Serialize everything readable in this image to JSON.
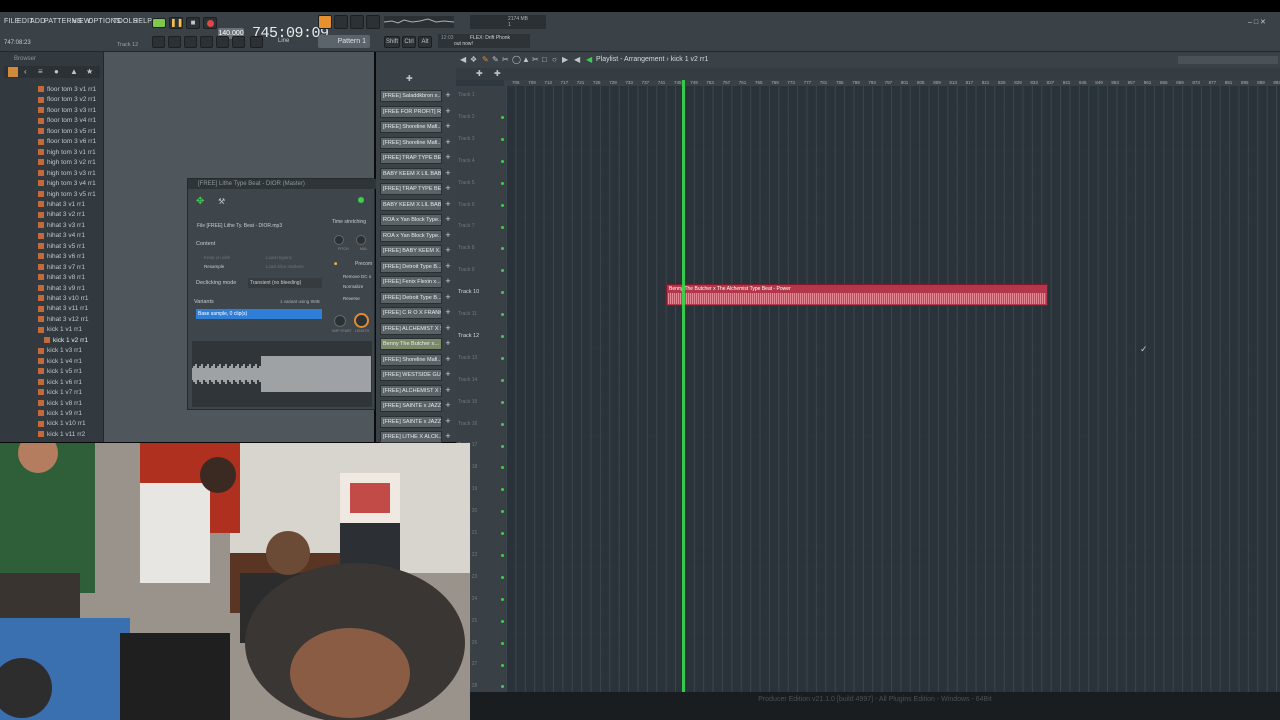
{
  "menu": [
    "FILE",
    "EDIT",
    "ADD",
    "PATTERNS",
    "VIEW",
    "OPTIONS",
    "TOOLS",
    "HELP"
  ],
  "transport": {
    "tempo": "140.000",
    "time": "745:09:09",
    "song_pos": "747:08:23",
    "track_hint": "Track 12",
    "pattern": "Pattern 1",
    "snap": "Line",
    "mem": "2174 MB",
    "cpu": "1"
  },
  "news": {
    "line1": "FLEX: Drift Phonk",
    "line2": "out now!",
    "code": "12:03"
  },
  "browser": {
    "title": "Browser",
    "items": [
      "floor tom 3 v1 rr1",
      "floor tom 3 v2 rr1",
      "floor tom 3 v3 rr1",
      "floor tom 3 v4 rr1",
      "floor tom 3 v5 rr1",
      "floor tom 3 v6 rr1",
      "high tom 3 v1 rr1",
      "high tom 3 v2 rr1",
      "high tom 3 v3 rr1",
      "high tom 3 v4 rr1",
      "high tom 3 v5 rr1",
      "hihat 3 v1 rr1",
      "hihat 3 v2 rr1",
      "hihat 3 v3 rr1",
      "hihat 3 v4 rr1",
      "hihat 3 v5 rr1",
      "hihat 3 v6 rr1",
      "hihat 3 v7 rr1",
      "hihat 3 v8 rr1",
      "hihat 3 v9 rr1",
      "hihat 3 v10 rr1",
      "hihat 3 v11 rr1",
      "hihat 3 v12 rr1",
      "kick 1 v1 rr1",
      "kick 1 v2 rr1",
      "kick 1 v3 rr1",
      "kick 1 v4 rr1",
      "kick 1 v5 rr1",
      "kick 1 v6 rr1",
      "kick 1 v7 rr1",
      "kick 1 v8 rr1",
      "kick 1 v9 rr1",
      "kick 1 v10 rr1",
      "kick 1 v11 rr2"
    ]
  },
  "sampler": {
    "title": "[FREE] Lithe Type Beat - DIOR (Master)",
    "file": "File  [FREE] Lithe Ty. Beat - DIOR.mp3",
    "time_stretching": "Time stretching",
    "content": "Content",
    "keep_on_disk": "Keep on disk",
    "resample": "Resample",
    "load_regions": "Load regions",
    "load_slice_markers": "Load slice markers",
    "declicking_label": "Declicking mode",
    "declicking_value": "Transient (no bleeding)",
    "precompute": "Precom",
    "remove_dc": "Remove DC o",
    "normalize": "Normalize",
    "reverse": "Reverse",
    "variants": "Variants",
    "variants_info": "1 variant using 9MB",
    "variant_selected": "Base sample, 0 clip(s)",
    "pitch": "PITCH",
    "mul": "MUL",
    "smp_start": "SMP START",
    "length": "LENGTH"
  },
  "patterns": [
    "[FREE] Saladdkbron x...",
    "[FREE FOR PROFIT] R...",
    "[FREE] Shoreline Mafi...",
    "[FREE] Shoreline Mafi...",
    "[FREE] TRAP TYPE BE...",
    "BABY KEEM X LIL BAB...",
    "[FREE] TRAP TYPE BE...",
    "BABY KEEM X LIL BAB...",
    "ROA x Yan Block Type...",
    "ROA x Yan Block Type...",
    "[FREE] BABY KEEM X...",
    "[FREE] Detroit Type B...",
    "[FREE] Fenix Flexin x...",
    "[FREE] Detroit Type B...",
    "[FREE] C R O X FRANK...",
    "[FREE] ALCHEMIST X S...",
    "Benny The Butcher x...",
    "[FREE] Shoreline Mafi...",
    "[FREE] WESTSIDE GUN...",
    "[FREE] ALCHEMIST X S...",
    "[FREE] SAINTE x JAZZ...",
    "[FREE] SAINTE x JAZZ...",
    "[FREE] LITHE X ALCK..."
  ],
  "playlist": {
    "breadcrumb": "Playlist - Arrangement › kick 1 v2 rr1",
    "ruler": [
      "705",
      "709",
      "713",
      "717",
      "721",
      "725",
      "729",
      "733",
      "737",
      "741",
      "745",
      "749",
      "753",
      "757",
      "761",
      "765",
      "769",
      "773",
      "777",
      "781",
      "785",
      "789",
      "793",
      "797",
      "801",
      "805",
      "809",
      "813",
      "817",
      "821",
      "825",
      "829",
      "833",
      "837",
      "841",
      "845",
      "849",
      "853",
      "857",
      "861",
      "865",
      "869",
      "873",
      "877",
      "881",
      "885",
      "889",
      "893"
    ],
    "tracks": [
      "Track 1",
      "Track 2",
      "Track 3",
      "Track 4",
      "Track 5",
      "Track 6",
      "Track 7",
      "Track 8",
      "Track 9",
      "Track 10",
      "Track 11",
      "Track 12",
      "Track 13",
      "Track 14",
      "Track 15",
      "Track 16",
      "Track 17",
      "Track 18",
      "Track 19",
      "Track 20",
      "Track 21",
      "Track 22",
      "Track 23",
      "Track 24",
      "Track 25",
      "Track 26",
      "Track 27",
      "Track 28"
    ],
    "clip_name": "Benny The Butcher x The Alchemist Type Beat - Power"
  },
  "status": "Producer Edition v21.1.0 [build 4997] - All Plugins Edition - Windows - 64Bit",
  "colors": {
    "accent_green": "#37d24a",
    "clip_red": "#b3364a",
    "panel": "#3b4247"
  }
}
